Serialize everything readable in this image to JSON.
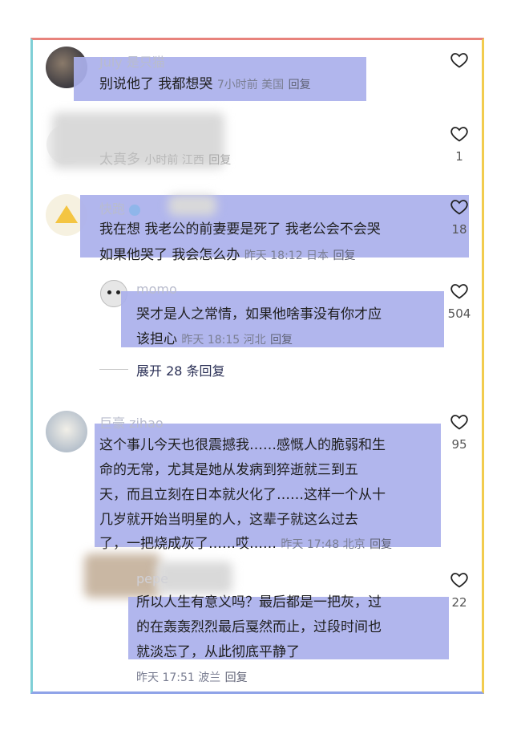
{
  "comments": [
    {
      "name": "July 是只猫",
      "lines": [
        "别说他了 我都想哭"
      ],
      "meta": "7小时前 美国",
      "reply": "回复",
      "likes": ""
    },
    {
      "lines": [
        "太真多"
      ],
      "meta": "小时前 江西",
      "reply": "回复",
      "likes": "1"
    },
    {
      "name": "快跑 ",
      "lines": [
        "我在想 我老公的前妻要是死了 我老公会不会哭",
        "如果他哭了 我会怎么办"
      ],
      "meta": "昨天 18:12 日本",
      "reply": "回复",
      "likes": "18"
    },
    {
      "name": "momo",
      "lines": [
        "哭才是人之常情，如果他啥事没有你才应",
        "该担心"
      ],
      "meta": "昨天 18:15 河北",
      "reply": "回复",
      "likes": "504"
    },
    {
      "name": "巨豪 zihao",
      "lines": [
        "这个事儿今天也很震撼我……感慨人的脆弱和生",
        "命的无常，尤其是她从发病到猝逝就三到五",
        "天，而且立刻在日本就火化了……这样一个从十",
        "几岁就开始当明星的人，这辈子就这么过去",
        "了，一把烧成灰了……哎……"
      ],
      "meta": "昨天 17:48 北京",
      "reply": "回复",
      "likes": "95"
    },
    {
      "name": "pepe",
      "lines": [
        "所以人生有意义吗？最后都是一把灰，过",
        "的在轰轰烈烈最后戛然而止，过段时间也",
        "就淡忘了，从此彻底平静了"
      ],
      "meta": "昨天 17:51 波兰",
      "reply": "回复",
      "likes": "22"
    }
  ],
  "expand_replies": "展开 28 条回复",
  "colors": {
    "highlight": "#aab0ec",
    "frame_top": "#e8837c",
    "frame_right": "#f2cc4e",
    "frame_bottom": "#8fa3e8",
    "frame_left": "#7fcfd6"
  }
}
